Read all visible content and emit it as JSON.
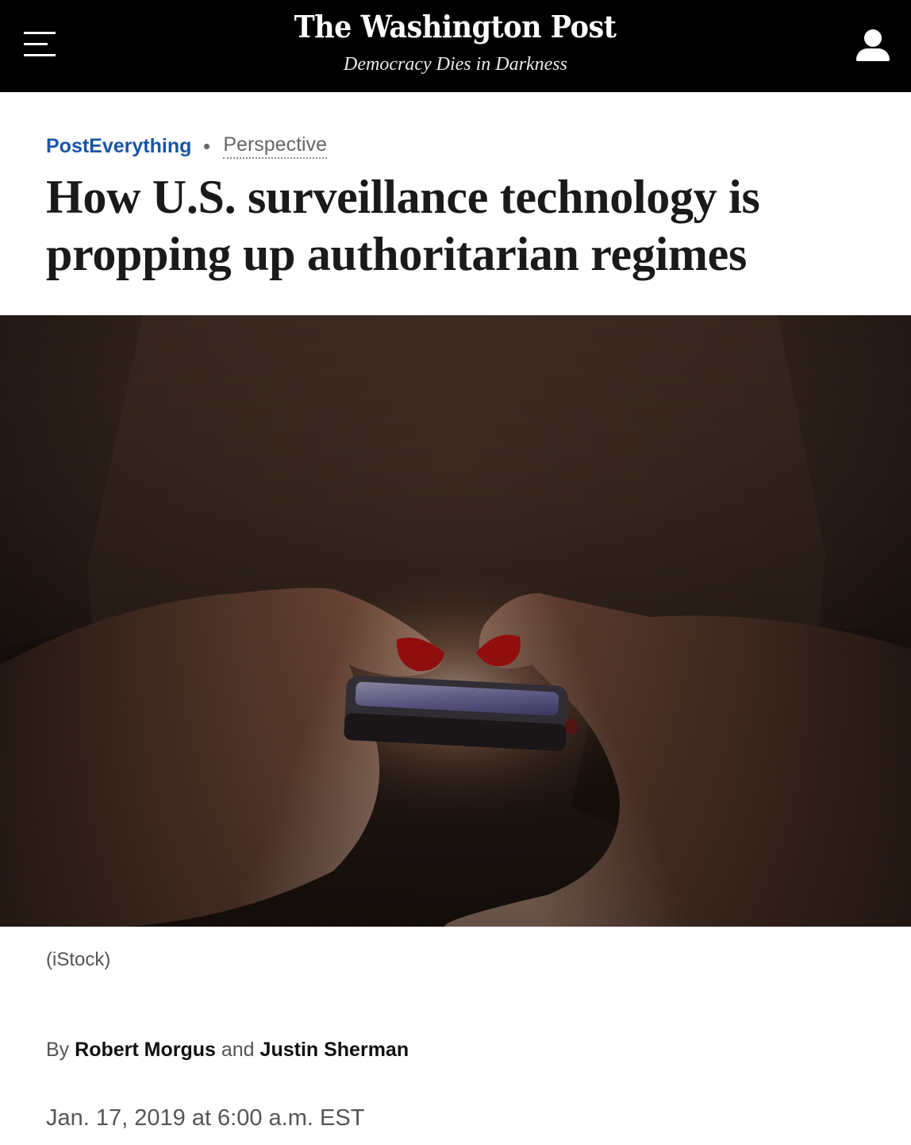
{
  "header": {
    "logo_text": "The Washington Post",
    "tagline": "Democracy Dies in Darkness",
    "menu_icon": "hamburger-menu-icon",
    "account_icon": "user-account-icon",
    "background_color": "#000000"
  },
  "article": {
    "kicker_section": "PostEverything",
    "kicker_label": "Perspective",
    "kicker_color": "#1955a5",
    "headline": "How U.S. surveillance technology is propping up authoritarian regimes",
    "image_caption": "(iStock)",
    "byline_prefix": "By",
    "authors": [
      "Robert Morgus",
      "Justin Sherman"
    ],
    "byline_conjunction": "and",
    "published": "Jan. 17, 2019 at 6:00 a.m. EST"
  }
}
